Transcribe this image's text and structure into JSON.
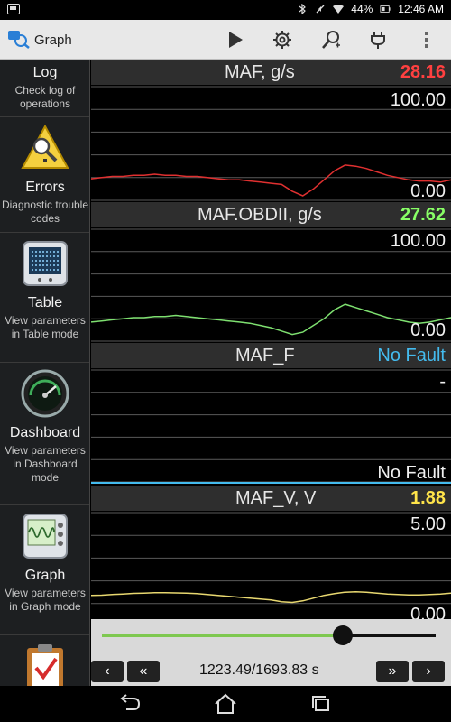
{
  "status_bar": {
    "battery": "44%",
    "time": "12:46 AM"
  },
  "app": {
    "title": "Graph"
  },
  "action_bar": {
    "icons": [
      "play-icon",
      "settings-icon",
      "search-icon",
      "plug-icon",
      "overflow-menu-icon"
    ]
  },
  "sidebar": {
    "items": [
      {
        "title": "Log",
        "desc": "Check log of operations"
      },
      {
        "title": "Errors",
        "desc": "Diagnostic trouble codes"
      },
      {
        "title": "Table",
        "desc": "View parameters in Table mode"
      },
      {
        "title": "Dashboard",
        "desc": "View parameters in Dashboard mode"
      },
      {
        "title": "Graph",
        "desc": "View parameters in Graph mode"
      }
    ]
  },
  "panels": [
    {
      "name": "MAF, g/s",
      "value": "28.16",
      "value_color": "#ff4040",
      "scale_top": "100.00",
      "scale_bottom": "0.00",
      "line_color": "#e03030"
    },
    {
      "name": "MAF.OBDII, g/s",
      "value": "27.62",
      "value_color": "#88ff66",
      "scale_top": "100.00",
      "scale_bottom": "0.00",
      "line_color": "#7ee070"
    },
    {
      "name": "MAF_F",
      "value": "No Fault",
      "value_color": "#44bbee",
      "scale_top": "-",
      "scale_bottom": "No Fault",
      "line_color": "#44bbee"
    },
    {
      "name": "MAF_V, V",
      "value": "1.88",
      "value_color": "#ffe44a",
      "scale_top": "5.00",
      "scale_bottom": "0.00",
      "line_color": "#e8d870"
    }
  ],
  "chart_data": [
    {
      "type": "line",
      "series": [
        {
          "name": "MAF, g/s",
          "values": [
            19,
            20,
            21,
            21,
            22,
            22,
            23,
            22,
            22,
            21,
            21,
            20,
            19,
            18,
            18,
            17,
            16,
            15,
            14,
            8,
            4,
            10,
            18,
            26,
            31,
            30,
            28,
            25,
            22,
            20,
            18,
            17,
            17,
            16,
            18
          ]
        }
      ],
      "ylim": [
        0,
        100
      ]
    },
    {
      "type": "line",
      "series": [
        {
          "name": "MAF.OBDII, g/s",
          "values": [
            17,
            18,
            19,
            20,
            21,
            21,
            22,
            22,
            23,
            22,
            21,
            20,
            19,
            18,
            17,
            16,
            14,
            12,
            9,
            6,
            8,
            14,
            20,
            28,
            33,
            30,
            27,
            24,
            21,
            19,
            17,
            16,
            17,
            19,
            21
          ]
        }
      ],
      "ylim": [
        0,
        100
      ]
    },
    {
      "type": "line",
      "series": [
        {
          "name": "MAF_F",
          "values": []
        }
      ]
    },
    {
      "type": "line",
      "series": [
        {
          "name": "MAF_V, V",
          "values": [
            1.36,
            1.37,
            1.4,
            1.42,
            1.45,
            1.46,
            1.48,
            1.48,
            1.47,
            1.46,
            1.44,
            1.4,
            1.36,
            1.32,
            1.28,
            1.24,
            1.2,
            1.16,
            1.08,
            1.05,
            1.12,
            1.24,
            1.36,
            1.44,
            1.5,
            1.52,
            1.5,
            1.46,
            1.42,
            1.4,
            1.38,
            1.38,
            1.4,
            1.42,
            1.46
          ]
        }
      ],
      "ylim": [
        0,
        5
      ]
    }
  ],
  "controls": {
    "time": "1223.49/1693.83 s",
    "position": 0.722,
    "prev": "‹",
    "rewind": "«",
    "forward": "»",
    "next": "›"
  }
}
